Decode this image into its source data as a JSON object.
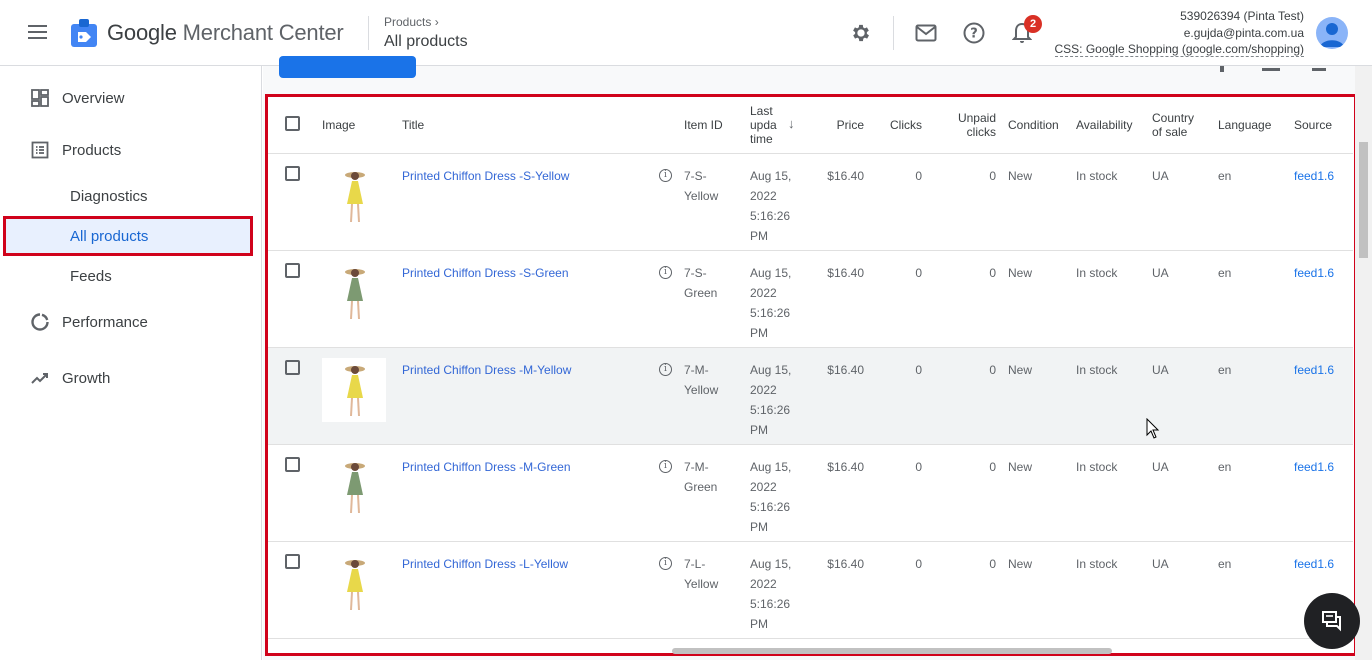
{
  "header": {
    "app_title_google": "Google",
    "app_title_rest": "Merchant Center",
    "breadcrumb_parent": "Products",
    "breadcrumb_current": "All products",
    "notification_count": "2",
    "account_id": "539026394 (Pinta Test)",
    "account_email": "e.gujda@pinta.com.ua",
    "account_css": "CSS: Google Shopping (google.com/shopping)"
  },
  "sidebar": {
    "overview": "Overview",
    "products": "Products",
    "diagnostics": "Diagnostics",
    "all_products": "All products",
    "feeds": "Feeds",
    "performance": "Performance",
    "growth": "Growth"
  },
  "table": {
    "headers": {
      "image": "Image",
      "title": "Title",
      "item_id": "Item ID",
      "last_update": "Last upda time",
      "price": "Price",
      "clicks": "Clicks",
      "unpaid_clicks": "Unpaid clicks",
      "condition": "Condition",
      "availability": "Availability",
      "country": "Country of sale",
      "language": "Language",
      "source": "Source"
    },
    "rows": [
      {
        "title": "Printed Chiffon Dress -S-Yellow",
        "item_id": "7-S-Yellow",
        "updated": "Aug 15, 2022 5:16:26 PM",
        "price": "$16.40",
        "clicks": "0",
        "unpaid": "0",
        "condition": "New",
        "availability": "In stock",
        "country": "UA",
        "language": "en",
        "source": "feed1.6",
        "dress_color": "#e8d84a"
      },
      {
        "title": "Printed Chiffon Dress -S-Green",
        "item_id": "7-S-Green",
        "updated": "Aug 15, 2022 5:16:26 PM",
        "price": "$16.40",
        "clicks": "0",
        "unpaid": "0",
        "condition": "New",
        "availability": "In stock",
        "country": "UA",
        "language": "en",
        "source": "feed1.6",
        "dress_color": "#7d9a72"
      },
      {
        "title": "Printed Chiffon Dress -M-Yellow",
        "item_id": "7-M-Yellow",
        "updated": "Aug 15, 2022 5:16:26 PM",
        "price": "$16.40",
        "clicks": "0",
        "unpaid": "0",
        "condition": "New",
        "availability": "In stock",
        "country": "UA",
        "language": "en",
        "source": "feed1.6",
        "dress_color": "#e8d84a"
      },
      {
        "title": "Printed Chiffon Dress -M-Green",
        "item_id": "7-M-Green",
        "updated": "Aug 15, 2022 5:16:26 PM",
        "price": "$16.40",
        "clicks": "0",
        "unpaid": "0",
        "condition": "New",
        "availability": "In stock",
        "country": "UA",
        "language": "en",
        "source": "feed1.6",
        "dress_color": "#7d9a72"
      },
      {
        "title": "Printed Chiffon Dress -L-Yellow",
        "item_id": "7-L-Yellow",
        "updated": "Aug 15, 2022 5:16:26 PM",
        "price": "$16.40",
        "clicks": "0",
        "unpaid": "0",
        "condition": "New",
        "availability": "In stock",
        "country": "UA",
        "language": "en",
        "source": "feed1.6",
        "dress_color": "#e8d84a"
      }
    ]
  },
  "icons": [
    "menu-icon",
    "merchant-logo-icon",
    "settings-icon",
    "mail-icon",
    "help-icon",
    "notifications-icon",
    "avatar-icon",
    "overview-icon",
    "products-icon",
    "performance-icon",
    "growth-icon",
    "info-icon",
    "sort-down-icon",
    "chat-icon"
  ],
  "colors": {
    "accent": "#1a73e8",
    "highlight_border": "#d0021b",
    "active_bg": "#e8f0fe"
  }
}
